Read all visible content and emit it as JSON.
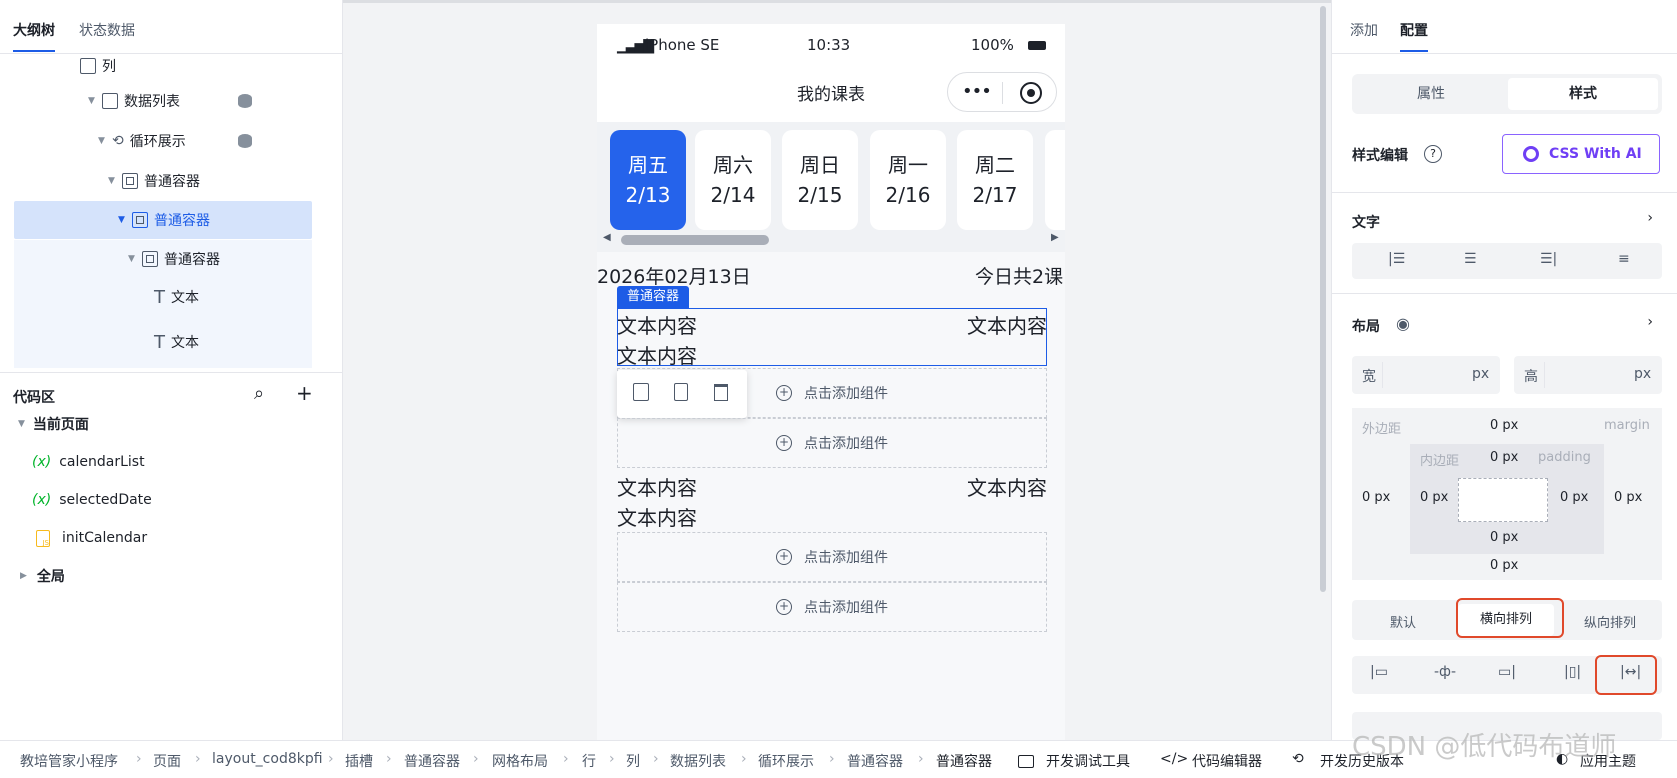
{
  "left": {
    "tabs": [
      "大纲树",
      "状态数据"
    ],
    "tree": [
      {
        "label": "列",
        "indent": 0
      },
      {
        "label": "数据列表"
      },
      {
        "label": "循环展示"
      },
      {
        "label": "普通容器"
      },
      {
        "label": "普通容器"
      },
      {
        "label": "普通容器"
      },
      {
        "label": "文本"
      },
      {
        "label": "文本"
      }
    ],
    "code_title": "代码区",
    "current_page": "当前页面",
    "vars": [
      "calendarList",
      "selectedDate"
    ],
    "var_prefix": "(x)",
    "js_item": "initCalendar",
    "global": "全局"
  },
  "phone": {
    "device": "iPhone SE",
    "time": "10:33",
    "battery": "100%",
    "title": "我的课表",
    "days": [
      {
        "week": "周五",
        "date": "2/13"
      },
      {
        "week": "周六",
        "date": "2/14"
      },
      {
        "week": "周日",
        "date": "2/15"
      },
      {
        "week": "周一",
        "date": "2/16"
      },
      {
        "week": "周二",
        "date": "2/17"
      }
    ],
    "date_text": "2026年02月13日",
    "count_text": "今日共2课",
    "container_tag": "普通容器",
    "text_content": "文本内容",
    "add_component": "点击添加组件"
  },
  "right": {
    "tabs": [
      "添加",
      "配置"
    ],
    "seg": [
      "属性",
      "样式"
    ],
    "style_edit": "样式编辑",
    "css_ai": "CSS With AI",
    "text_section": "文字",
    "layout_section": "布局",
    "width_label": "宽",
    "height_label": "高",
    "unit": "px",
    "margin_label": "外边距",
    "margin_en": "margin",
    "padding_label": "内边距",
    "padding_en": "padding",
    "zero_px": "0 px",
    "direction": [
      "默认",
      "横向排列",
      "纵向排列"
    ]
  },
  "crumbs": [
    "教培管家小程序",
    "页面",
    "layout_cod8kpfi",
    "插槽",
    "普通容器",
    "网格布局",
    "行",
    "列",
    "数据列表",
    "循环展示",
    "普通容器",
    "普通容器"
  ],
  "tools": [
    "开发调试工具",
    "代码编辑器",
    "开发历史版本",
    "应用主题"
  ],
  "watermark": "CSDN @低代码布道师"
}
